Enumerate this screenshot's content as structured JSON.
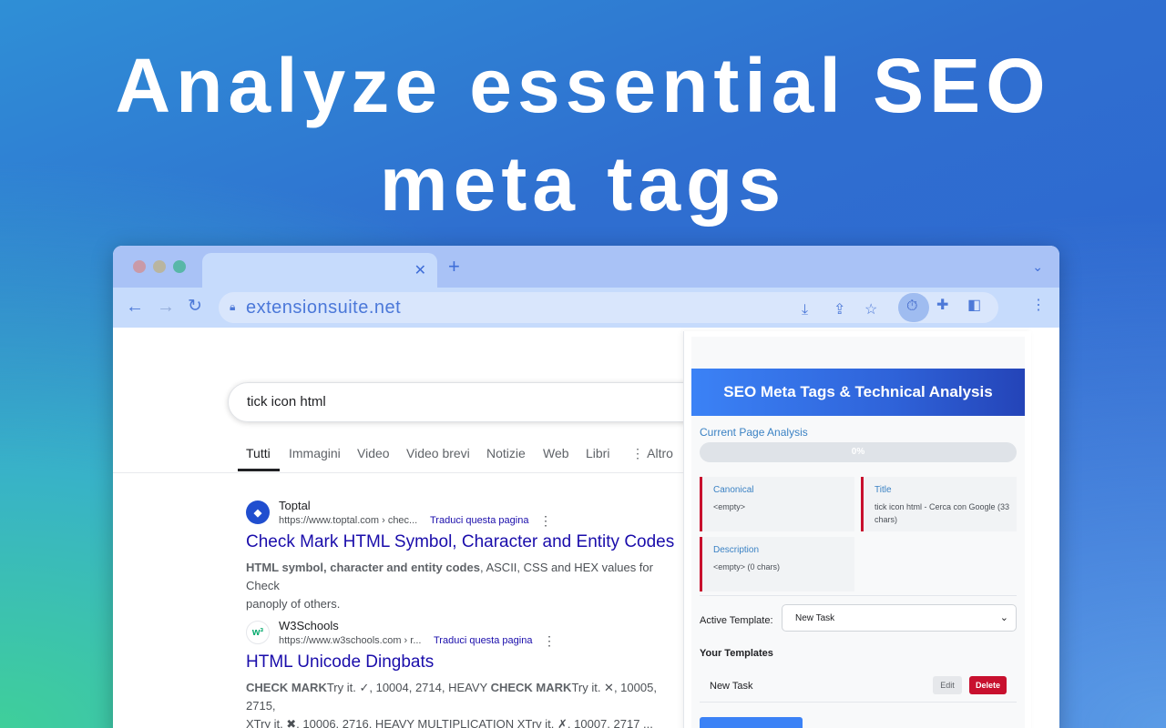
{
  "headline": {
    "line1": "Analyze essential SEO",
    "line2": "meta tags"
  },
  "browser": {
    "tab": {
      "close_icon": "close-icon",
      "new_tab_icon": "plus-icon"
    },
    "toolbar": {
      "url": "extensionsuite.net",
      "icons": [
        "arrow-left-icon",
        "arrow-right-icon",
        "reload-icon",
        "lock-icon",
        "install-icon",
        "share-icon",
        "star-icon",
        "extension-active-icon",
        "puzzle-icon",
        "sidepanel-icon",
        "kebab-menu-icon"
      ]
    }
  },
  "google": {
    "query": "tick icon html",
    "tabs": [
      "Tutti",
      "Immagini",
      "Video",
      "Video brevi",
      "Notizie",
      "Web",
      "Libri",
      "⋮ Altro"
    ],
    "results": [
      {
        "site": "Toptal",
        "url": "https://www.toptal.com › chec...",
        "translate": "Traduci questa pagina",
        "title": "Check Mark HTML Symbol, Character and Entity Codes",
        "snippet_bold": "HTML symbol, character and entity codes",
        "snippet_rest": ", ASCII, CSS and HEX values for Check",
        "snippet_line2": "panoply of others."
      },
      {
        "site": "W3Schools",
        "url": "https://www.w3schools.com › r...",
        "translate": "Traduci questa pagina",
        "title": "HTML Unicode Dingbats",
        "snippet_line1_a": "CHECK MARK",
        "snippet_line1_b": "Try it. ✓, 10004, 2714, HEAVY ",
        "snippet_line1_c": "CHECK MARK",
        "snippet_line1_d": "Try it. ✕, 10005, 2715,",
        "snippet_line2": "XTry it. ✖, 10006, 2716, HEAVY MULTIPLICATION XTry it. ✗, 10007, 2717 ..."
      }
    ]
  },
  "panel": {
    "header": "SEO Meta Tags & Technical Analysis",
    "section_title": "Current Page Analysis",
    "progress_percent": 0,
    "progress_label": "0%",
    "cards": [
      {
        "label": "Canonical",
        "value": "<empty>"
      },
      {
        "label": "Title",
        "value": "tick icon html - Cerca con Google (33 chars)"
      },
      {
        "label": "Description",
        "value": "<empty> (0 chars)"
      }
    ],
    "active_template_label": "Active Template:",
    "active_template_value": "New Task",
    "your_templates_label": "Your Templates",
    "templates": [
      {
        "name": "New Task",
        "edit_label": "Edit",
        "delete_label": "Delete"
      }
    ]
  },
  "colors": {
    "accent": "#3b82f6",
    "danger": "#c8102e",
    "link": "#1a0dab",
    "browser_chrome": "#c6dbfc"
  }
}
